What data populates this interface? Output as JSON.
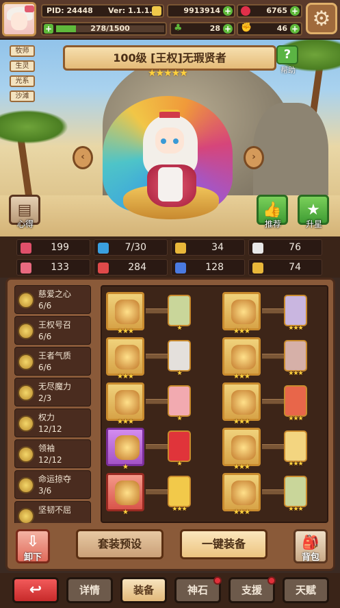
{
  "header": {
    "pid_label": "PID: 24448",
    "version_label": "Ver: 1.1.1.3",
    "gold": "9913914",
    "ruby": "6765",
    "exp_text": "278/1500",
    "exp_progress": 0.185,
    "clover": "28",
    "flex": "46"
  },
  "class_tags": [
    "牧师",
    "生灵",
    "光系",
    "沙滩"
  ],
  "hero": {
    "title": "100级 [王权]无瑕贤者",
    "stars": "★★★★★",
    "help_label": "帮助",
    "left_button": "心得",
    "recommend_button": "推荐",
    "star_up_button": "升星"
  },
  "stats": [
    {
      "icon": "heart-icon",
      "value": "199",
      "color": "#e0506a"
    },
    {
      "icon": "drop-icon",
      "value": "7/30",
      "color": "#3aa0e0"
    },
    {
      "icon": "shield-icon",
      "value": "34",
      "color": "#e8b73a"
    },
    {
      "icon": "wing-icon",
      "value": "76",
      "color": "#e8e8e8"
    },
    {
      "icon": "magic-book-icon",
      "value": "133",
      "color": "#e86a80"
    },
    {
      "icon": "red-book-icon",
      "value": "284",
      "color": "#e04a4a"
    },
    {
      "icon": "scroll-icon",
      "value": "128",
      "color": "#4a7ae0"
    },
    {
      "icon": "horseshoe-icon",
      "value": "74",
      "color": "#e8b73a"
    }
  ],
  "skills": [
    {
      "name": "慈爱之心",
      "level": "6/6"
    },
    {
      "name": "王权号召",
      "level": "6/6"
    },
    {
      "name": "王者气质",
      "level": "6/6"
    },
    {
      "name": "无尽魔力",
      "level": "2/3"
    },
    {
      "name": "权力",
      "level": "12/12"
    },
    {
      "name": "领袖",
      "level": "12/12"
    },
    {
      "name": "命运掠夺",
      "level": "3/6"
    },
    {
      "name": "坚韧不屈",
      "level": ""
    }
  ],
  "equipment": {
    "star3": "★★★",
    "star1": "★"
  },
  "actions": {
    "unequip": "卸下",
    "preset": "套装预设",
    "equip_all": "一键装备",
    "bag": "背包"
  },
  "tabs": {
    "back": "",
    "details": "详情",
    "equip": "装备",
    "artifact": "神石",
    "support": "支援",
    "talent": "天赋"
  }
}
